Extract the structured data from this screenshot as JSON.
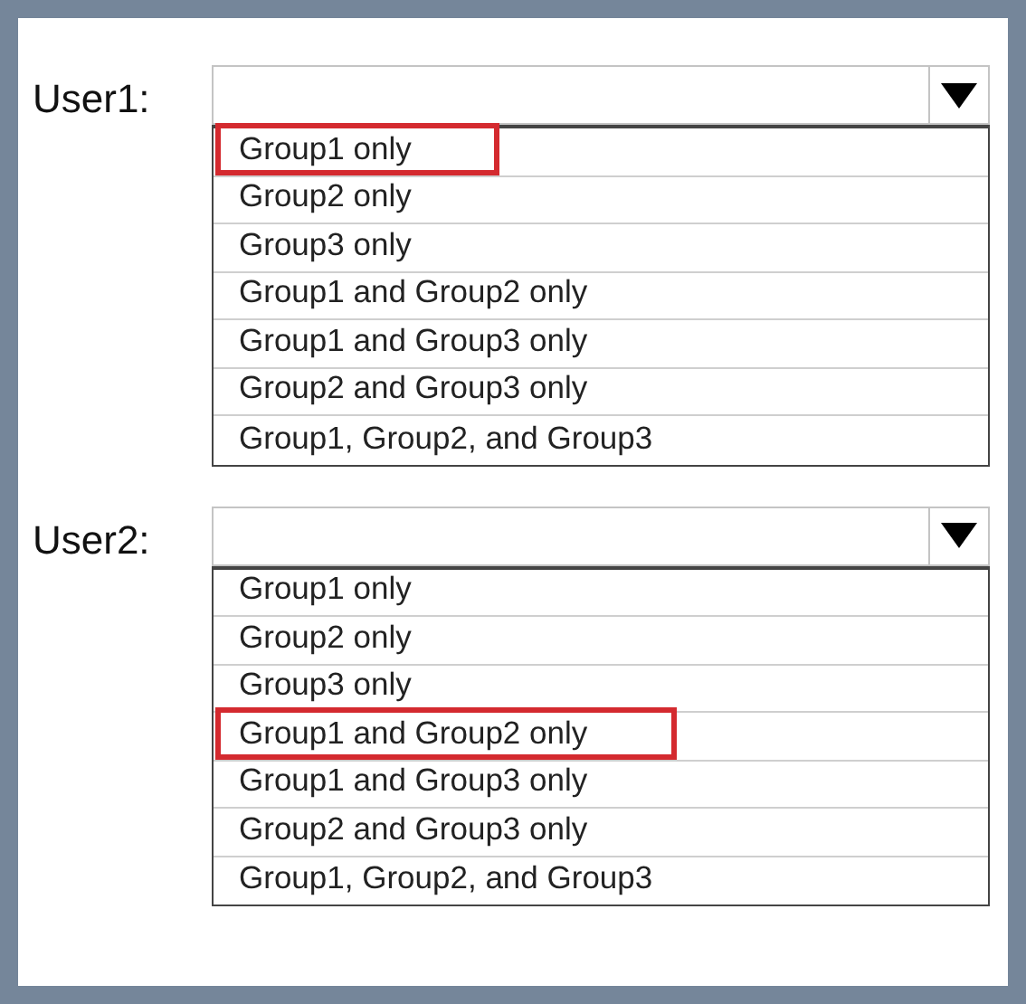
{
  "dropdowns": [
    {
      "label": "User1:",
      "options": [
        {
          "label": "Group1 only",
          "selected": true
        },
        {
          "label": "Group2 only",
          "selected": false
        },
        {
          "label": "Group3 only",
          "selected": false
        },
        {
          "label": "Group1 and Group2 only",
          "selected": false
        },
        {
          "label": "Group1 and Group3 only",
          "selected": false
        },
        {
          "label": "Group2 and Group3 only",
          "selected": false
        },
        {
          "label": "Group1, Group2, and Group3",
          "selected": false
        }
      ]
    },
    {
      "label": "User2:",
      "options": [
        {
          "label": "Group1 only",
          "selected": false
        },
        {
          "label": "Group2 only",
          "selected": false
        },
        {
          "label": "Group3 only",
          "selected": false
        },
        {
          "label": "Group1 and Group2 only",
          "selected": true
        },
        {
          "label": "Group1 and Group3 only",
          "selected": false
        },
        {
          "label": "Group2 and Group3 only",
          "selected": false
        },
        {
          "label": "Group1, Group2, and Group3",
          "selected": false
        }
      ]
    }
  ]
}
